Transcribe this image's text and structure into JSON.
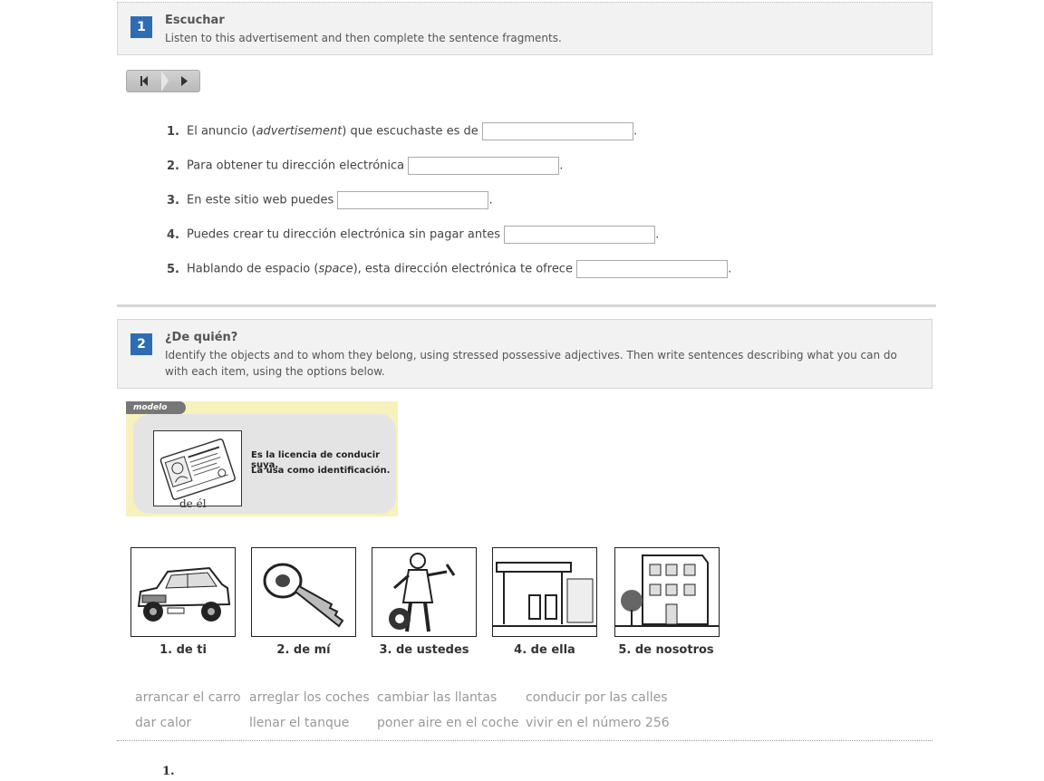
{
  "activity1": {
    "number": "1",
    "title": "Escuchar",
    "description": "Listen to this advertisement and then complete the sentence fragments.",
    "questions": [
      {
        "num": "1.",
        "before": "El anuncio (",
        "italic": "advertisement",
        "after": ") que escuchaste es de",
        "end": "."
      },
      {
        "num": "2.",
        "before": "Para obtener tu dirección electrónica",
        "italic": "",
        "after": "",
        "end": "."
      },
      {
        "num": "3.",
        "before": "En este sitio web puedes",
        "italic": "",
        "after": "",
        "end": "."
      },
      {
        "num": "4.",
        "before": "Puedes crear tu dirección electrónica sin pagar antes",
        "italic": "",
        "after": "",
        "end": "."
      },
      {
        "num": "5.",
        "before": "Hablando de espacio (",
        "italic": "space",
        "after": "), esta dirección electrónica te ofrece",
        "end": "."
      }
    ]
  },
  "player": {
    "prev_icon": "rewind-icon",
    "next_icon": "play-icon"
  },
  "activity2": {
    "number": "2",
    "title": "¿De quién?",
    "description": "Identify the objects and to whom they belong, using stressed possessive adjectives. Then write sentences describing what you can do with each item, using the options below.",
    "modelo": {
      "tag": "modelo",
      "caption": "de él",
      "line1": "Es la licencia de conducir suya.",
      "line2": "La usa como identificación."
    },
    "pictures": [
      {
        "caption": "1. de ti",
        "icon": "car-icon"
      },
      {
        "caption": "2. de mí",
        "icon": "key-icon"
      },
      {
        "caption": "3. de ustedes",
        "icon": "mechanic-icon"
      },
      {
        "caption": "4. de ella",
        "icon": "gas-station-icon"
      },
      {
        "caption": "5. de nosotros",
        "icon": "building-icon"
      }
    ],
    "options_row1": [
      "arrancar el carro",
      "arreglar los coches",
      "cambiar las llantas",
      "conducir por las calles"
    ],
    "options_row2": [
      "dar calor",
      "llenar el tanque",
      "poner aire en el coche",
      "vivir en el número 256"
    ],
    "answer_first_num": "1."
  },
  "colors": {
    "accent": "#2e6db4",
    "box_bg": "#f2f2f2",
    "modelo_bg": "#f7f1bd"
  }
}
